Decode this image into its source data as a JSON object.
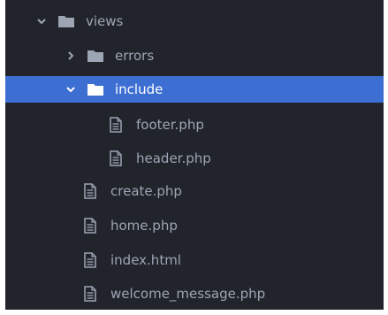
{
  "tree": {
    "views": {
      "label": "views",
      "icon": "folder-icon",
      "state": "expanded"
    },
    "errors": {
      "label": "errors",
      "icon": "folder-icon",
      "state": "collapsed"
    },
    "include": {
      "label": "include",
      "icon": "folder-icon",
      "state": "expanded",
      "selected": true
    },
    "footer": {
      "label": "footer.php",
      "icon": "file-text-icon"
    },
    "header": {
      "label": "header.php",
      "icon": "file-text-icon"
    },
    "create": {
      "label": "create.php",
      "icon": "file-text-icon"
    },
    "home": {
      "label": "home.php",
      "icon": "file-text-icon"
    },
    "index": {
      "label": "index.html",
      "icon": "file-text-icon"
    },
    "welcome": {
      "label": "welcome_message.php",
      "icon": "file-text-icon"
    }
  },
  "colors": {
    "panel_bg": "#21252b",
    "text": "#9da5b4",
    "selected_bg": "#3d6ed1",
    "selected_text": "#ffffff"
  }
}
